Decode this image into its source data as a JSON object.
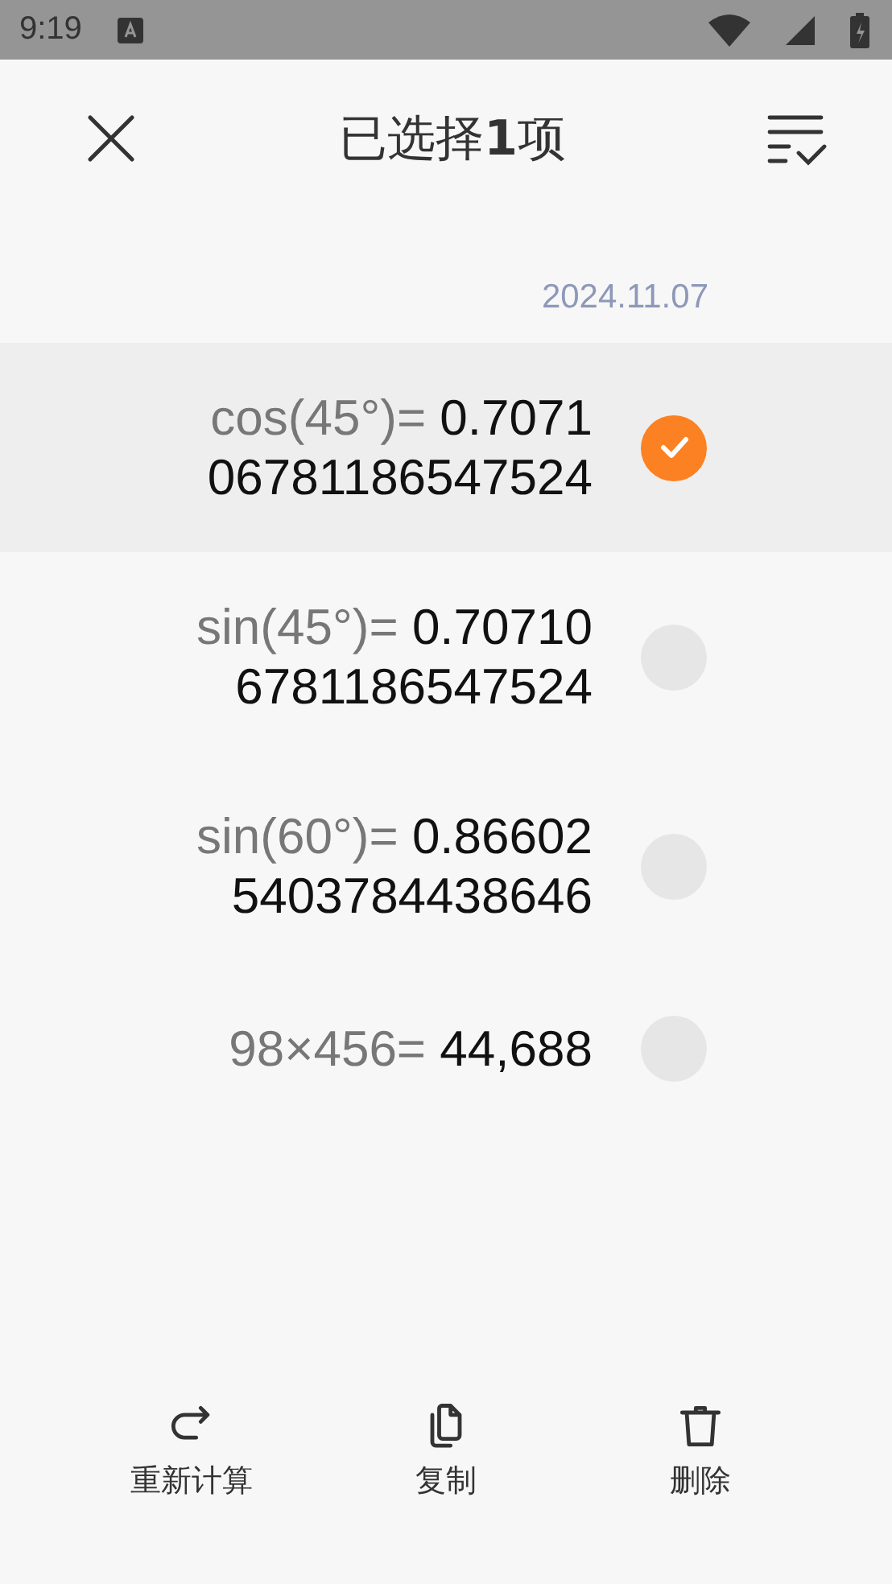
{
  "status_bar": {
    "time": "9:19"
  },
  "header": {
    "title": "已选择**1**项"
  },
  "date": "2024.11.07",
  "records": [
    {
      "expression": "cos(45°)=",
      "result": "0.707106781186547524",
      "selected": true
    },
    {
      "expression": "sin(45°)=",
      "result": "0.707106781186547524",
      "selected": false
    },
    {
      "expression": "sin(60°)=",
      "result": "0.866025403784438646",
      "selected": false
    },
    {
      "expression": "98×456=",
      "result": "44,688",
      "selected": false
    }
  ],
  "actions": [
    {
      "kind": "recalculate",
      "label": "重新计算"
    },
    {
      "kind": "copy",
      "label": "复制"
    },
    {
      "kind": "delete",
      "label": "删除"
    }
  ]
}
